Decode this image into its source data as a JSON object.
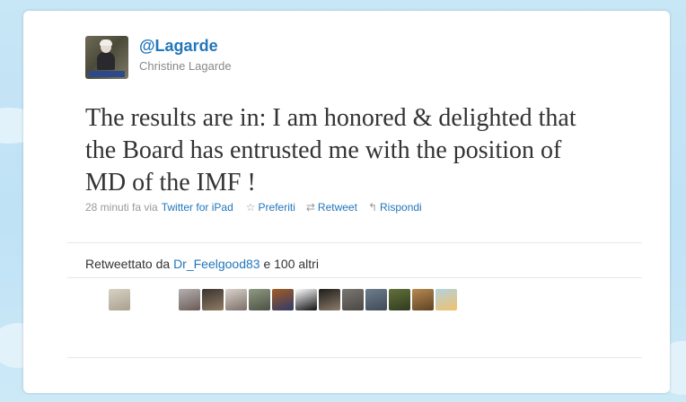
{
  "profile": {
    "handle": "@Lagarde",
    "name": "Christine Lagarde"
  },
  "tweet": {
    "text": "The results are in: I am honored & delighted that the Board has entrusted me with the position of MD of the IMF !"
  },
  "meta": {
    "time": "28 minuti fa via",
    "source": "Twitter for iPad",
    "favorite_label": "Preferiti",
    "retweet_label": "Retweet",
    "reply_label": "Rispondi"
  },
  "retweets": {
    "prefix": "Retweettato da",
    "user": "Dr_Feelgood83",
    "suffix": "e 100 altri"
  },
  "retweeter_avatars": [
    {
      "name": "retweeter-avatar-1",
      "colors": [
        "#d8d3c6",
        "#a99f8d"
      ]
    },
    {
      "name": "retweeter-avatar-2",
      "colors": [
        "#b4b1b0",
        "#6b5a56"
      ]
    },
    {
      "name": "retweeter-avatar-3",
      "colors": [
        "#3b3430",
        "#8f7b64"
      ]
    },
    {
      "name": "retweeter-avatar-4",
      "colors": [
        "#d9d3cd",
        "#7c6f66"
      ]
    },
    {
      "name": "retweeter-avatar-5",
      "colors": [
        "#8f9a82",
        "#4d5143"
      ]
    },
    {
      "name": "retweeter-avatar-6",
      "colors": [
        "#a45b24",
        "#2f3b6a"
      ]
    },
    {
      "name": "retweeter-avatar-7",
      "colors": [
        "#ffffff",
        "#111111"
      ]
    },
    {
      "name": "retweeter-avatar-8",
      "colors": [
        "#1f1d1a",
        "#8a7c6b"
      ]
    },
    {
      "name": "retweeter-avatar-9",
      "colors": [
        "#7a7773",
        "#4b4844"
      ]
    },
    {
      "name": "retweeter-avatar-10",
      "colors": [
        "#6f7d8e",
        "#3f4a56"
      ]
    },
    {
      "name": "retweeter-avatar-11",
      "colors": [
        "#63723a",
        "#2f3a1e"
      ]
    },
    {
      "name": "retweeter-avatar-12",
      "colors": [
        "#b78a52",
        "#5e4224"
      ]
    },
    {
      "name": "retweeter-avatar-13",
      "colors": [
        "#b4d2df",
        "#f0c16a"
      ]
    }
  ],
  "colors": {
    "link": "#2276bb",
    "text": "#333333",
    "muted": "#999999",
    "background": "#c7e6f6"
  }
}
